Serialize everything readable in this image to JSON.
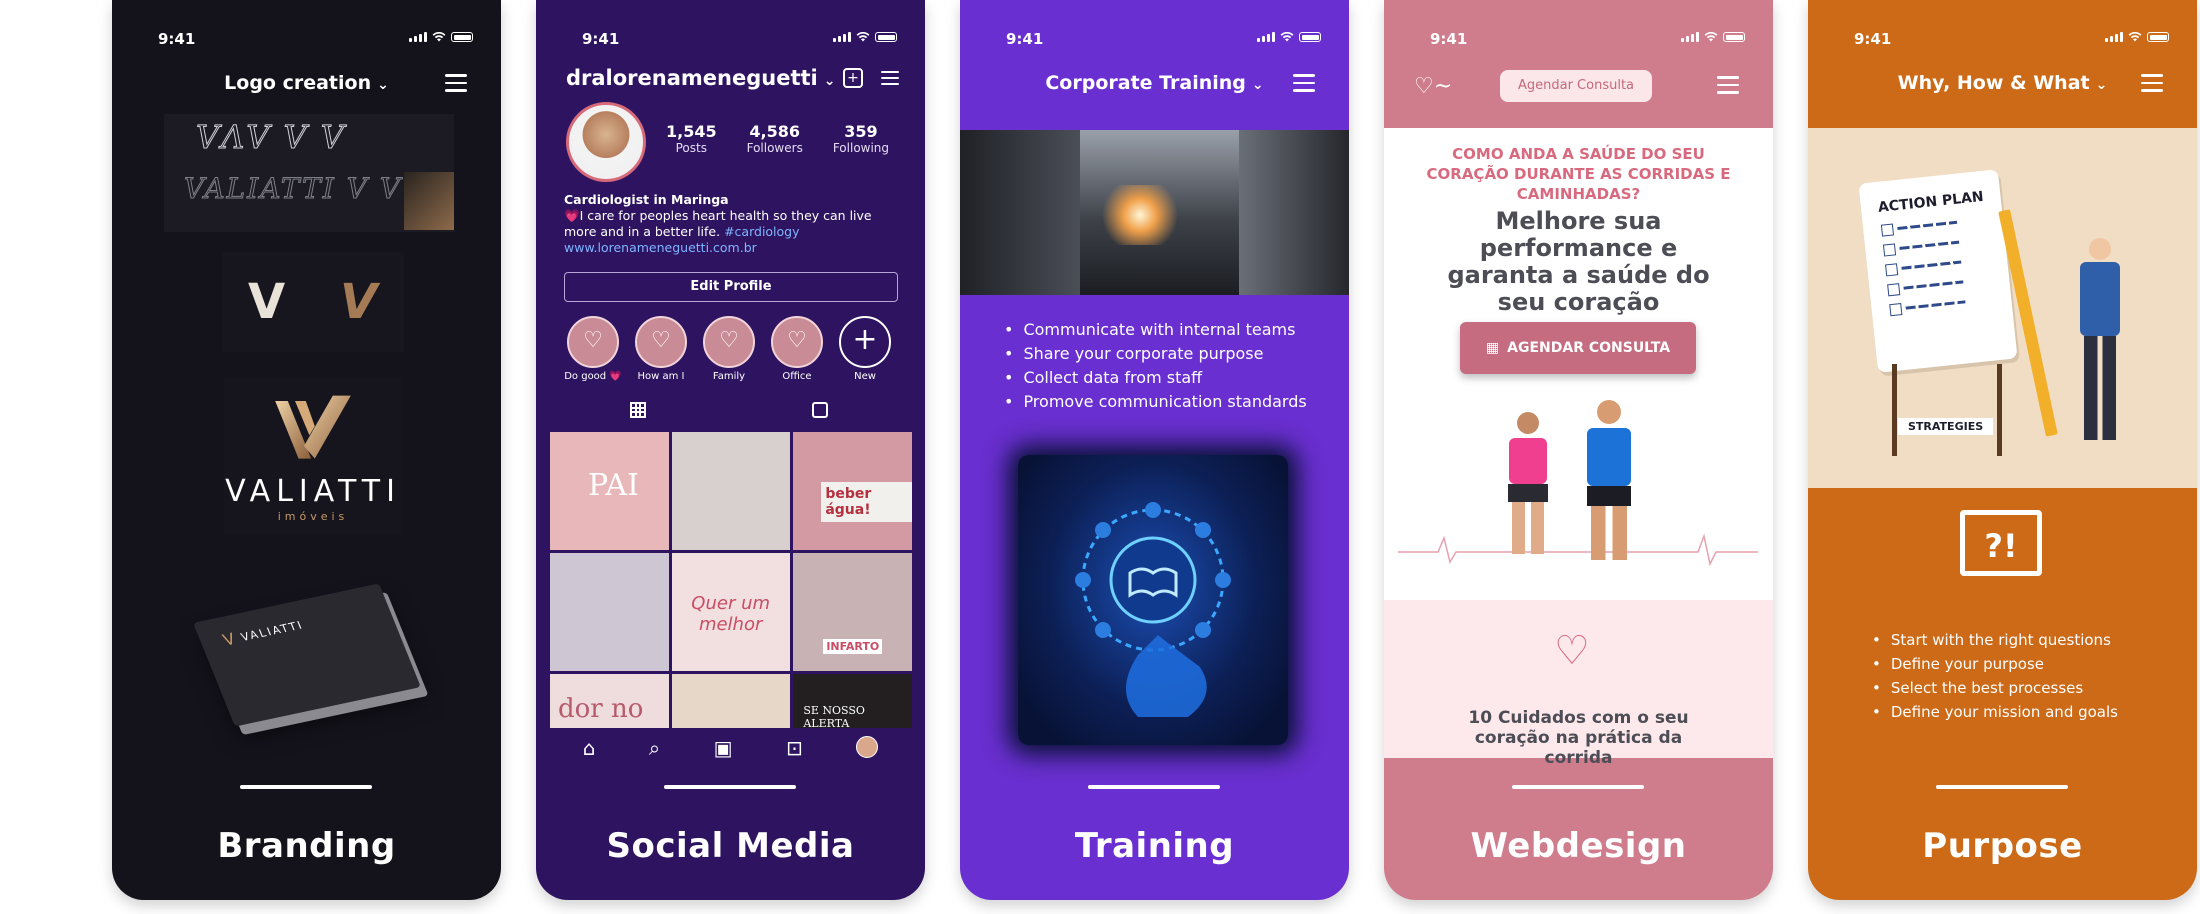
{
  "status_time": "9:41",
  "phones": [
    {
      "caption": "Branding",
      "nav_title": "Logo creation",
      "brand_name": "VALIATTI",
      "brand_sub": "imóveis",
      "card_name": "VALIATTI"
    },
    {
      "caption": "Social Media",
      "username": "dralorenameneguetti",
      "stats": [
        {
          "n": "1,545",
          "l": "Posts"
        },
        {
          "n": "4,586",
          "l": "Followers"
        },
        {
          "n": "359",
          "l": "Following"
        }
      ],
      "bio_title": "Cardiologist in Maringa",
      "bio_text": "💗I care for peoples heart health so they can live more and in a better life.",
      "bio_tag": "#cardiology",
      "bio_link": "www.lorenameneguetti.com.br",
      "edit_label": "Edit Profile",
      "highlights": [
        "Do good 💗",
        "How am I",
        "Family",
        "Office",
        "New"
      ],
      "posts": [
        {
          "bg": "#e8b7b9",
          "text": "PAI"
        },
        {
          "bg": "#d8cfcf",
          "text": ""
        },
        {
          "bg": "#d49aa4",
          "text": "beber água!"
        },
        {
          "bg": "#cfc6d3",
          "text": ""
        },
        {
          "bg": "#f2dfe0",
          "text": "Quer um melhor"
        },
        {
          "bg": "#c9b2b4",
          "text": "INFARTO"
        },
        {
          "bg": "#efdcdc",
          "text": "dor no"
        },
        {
          "bg": "#e7d7c8",
          "text": ""
        },
        {
          "bg": "#231f21",
          "text": "SE NOSSO ALERTA"
        }
      ]
    },
    {
      "caption": "Training",
      "nav_title": "Corporate Training",
      "bullets": [
        "Communicate with internal teams",
        "Share your corporate purpose",
        "Collect data from staff",
        "Promove communication standards"
      ]
    },
    {
      "caption": "Webdesign",
      "cta_pill": "Agendar Consulta",
      "question": "COMO ANDA A SAÚDE DO SEU CORAÇÃO DURANTE AS CORRIDAS E CAMINHADAS?",
      "headline": "Melhore sua performance e garanta a saúde do seu coração",
      "cta_button": "AGENDAR CONSULTA",
      "tip": "10 Cuidados com o seu coração na prática da corrida"
    },
    {
      "caption": "Purpose",
      "nav_title": "Why, How & What",
      "board_title": "ACTION PLAN",
      "strategies_label": "STRATEGIES",
      "bubble_text": "?!",
      "bullets": [
        "Start with the right questions",
        "Define your purpose",
        "Select the best processes",
        "Define your mission and goals"
      ]
    }
  ],
  "icons": [
    "signal-icon",
    "wifi-icon",
    "battery-icon",
    "hamburger-icon",
    "chevron-down-icon",
    "new-post-icon",
    "grid-icon",
    "tagged-icon",
    "home-icon",
    "search-icon",
    "reels-icon",
    "shop-icon",
    "calendar-icon",
    "heartbeat-icon"
  ]
}
